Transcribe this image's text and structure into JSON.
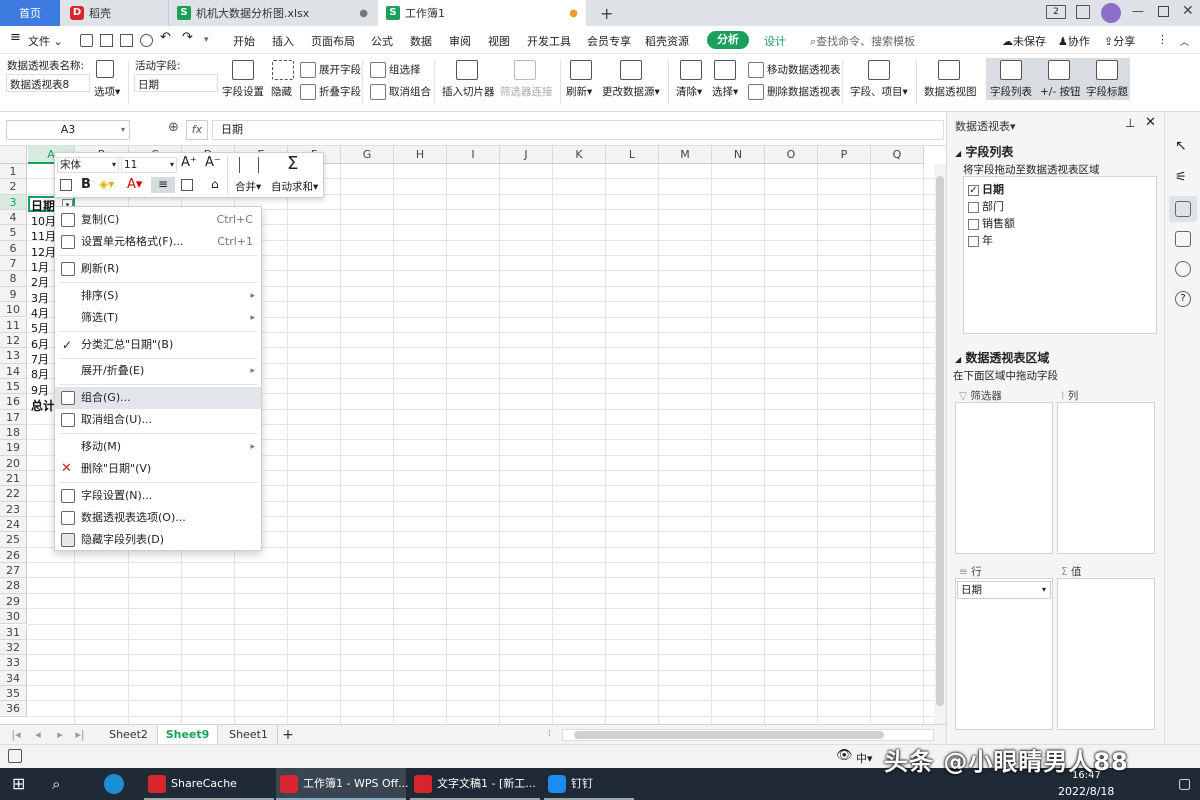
{
  "tabs": {
    "home": "首页",
    "daoke": "稻壳",
    "file1": "机机大数据分析图.xlsx",
    "file2": "工作簿1",
    "add": "+"
  },
  "window": {
    "badge": "2"
  },
  "menu": {
    "file": "文件",
    "items": [
      "开始",
      "插入",
      "页面布局",
      "公式",
      "数据",
      "审阅",
      "视图",
      "开发工具",
      "会员专享",
      "稻壳资源"
    ],
    "analyze": "分析",
    "design": "设计",
    "search_placeholder": "查找命令、搜索模板",
    "unsaved": "未保存",
    "collab": "协作",
    "share": "分享"
  },
  "ribbon": {
    "pivot_name_label": "数据透视表名称:",
    "pivot_name_value": "数据透视表8",
    "options": "选项",
    "active_field_label": "活动字段:",
    "active_field_value": "日期",
    "field_settings": "字段设置",
    "hide": "隐藏",
    "expand_field": "展开字段",
    "collapse_field": "折叠字段",
    "group_select": "组选择",
    "ungroup": "取消组合",
    "insert_slicer": "插入切片器",
    "filter_conn": "筛选器连接",
    "refresh": "刷新",
    "change_source": "更改数据源",
    "clear": "清除",
    "select": "选择",
    "move_pivot": "移动数据透视表",
    "delete_pivot": "删除数据透视表",
    "fields_items": "字段、项目",
    "pivot_chart": "数据透视图",
    "field_list": "字段列表",
    "plus_minus": "+/- 按钮",
    "field_headers": "字段标题"
  },
  "formula": {
    "cellref": "A3",
    "fx": "fx",
    "value": "日期"
  },
  "columns": [
    "A",
    "B",
    "C",
    "D",
    "E",
    "F",
    "G",
    "H",
    "I",
    "J",
    "K",
    "L",
    "M",
    "N",
    "O",
    "P",
    "Q"
  ],
  "rows": [
    "1",
    "2",
    "3",
    "4",
    "5",
    "6",
    "7",
    "8",
    "9",
    "10",
    "11",
    "12",
    "13",
    "14",
    "15",
    "16",
    "17",
    "18",
    "19",
    "20",
    "21",
    "22",
    "23",
    "24",
    "25",
    "26",
    "27",
    "28",
    "29",
    "30",
    "31",
    "32",
    "33",
    "34",
    "35",
    "36"
  ],
  "cells": {
    "a3": "日期",
    "a4": "10月",
    "a5": "11月",
    "a6": "12月",
    "a7": "1月",
    "a8": "2月",
    "a9": "3月",
    "a10": "4月",
    "a11": "5月",
    "a12": "6月",
    "a13": "7月",
    "a14": "8月",
    "a15": "9月",
    "a16": "总计"
  },
  "mini_toolbar": {
    "font": "宋体",
    "size": "11",
    "merge": "合并",
    "autosum": "自动求和"
  },
  "context_menu": {
    "copy": "复制(C)",
    "copy_sc": "Ctrl+C",
    "format_cells": "设置单元格格式(F)...",
    "format_sc": "Ctrl+1",
    "refresh": "刷新(R)",
    "sort": "排序(S)",
    "filter": "筛选(T)",
    "subtotal": "分类汇总\"日期\"(B)",
    "expand": "展开/折叠(E)",
    "group": "组合(G)...",
    "ungroup": "取消组合(U)...",
    "move": "移动(M)",
    "delete": "删除\"日期\"(V)",
    "field_settings": "字段设置(N)...",
    "pivot_options": "数据透视表选项(O)...",
    "hide_fieldlist": "隐藏字段列表(D)"
  },
  "sheets": [
    "Sheet2",
    "Sheet9",
    "Sheet1"
  ],
  "pane": {
    "title": "数据透视表",
    "field_list": "字段列表",
    "drag_hint": "将字段拖动至数据透视表区域",
    "fields": [
      {
        "name": "日期",
        "checked": true
      },
      {
        "name": "部门",
        "checked": false
      },
      {
        "name": "销售额",
        "checked": false
      },
      {
        "name": "年",
        "checked": false
      }
    ],
    "area_title": "数据透视表区域",
    "area_hint": "在下面区域中拖动字段",
    "filter": "筛选器",
    "col": "列",
    "row": "行",
    "value": "值",
    "row_item": "日期"
  },
  "taskbar": {
    "sharecache": "ShareCache",
    "wps1": "工作簿1 - WPS Off...",
    "wps2": "文字文稿1 - [新工...",
    "dingding": "钉钉",
    "time": "16:47",
    "date": "2022/8/18",
    "ime": "中"
  },
  "watermark": "头条 @小眼睛男人88"
}
